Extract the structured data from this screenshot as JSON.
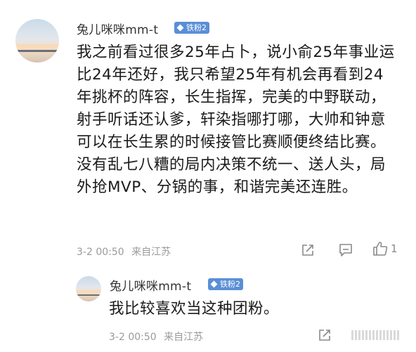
{
  "comments": [
    {
      "username": "兔儿咪咪mm-t",
      "badge": "铁粉2",
      "text": "我之前看过很多25年占卜，说小俞25年事业运比24年还好，我只希望25年有机会再看到24年挑杯的阵容，长生指挥，完美的中野联动，射手听话还认爹，轩染指哪打哪，大帅和钟意可以在长生累的时候接管比赛顺便终结比赛。没有乱七八糟的局内决策不统一、送人头，局外抢MVP、分锅的事，和谐完美还连胜。",
      "time": "3-2 00:50",
      "location": "来自江苏",
      "likes": "1"
    },
    {
      "username": "兔儿咪咪mm-t",
      "badge": "铁粉2",
      "text": "我比较喜欢当这种团粉。",
      "time": "3-2 00:50",
      "location": "来自江苏",
      "likes": ""
    }
  ],
  "colors": {
    "badge": "#5a8fd6",
    "meta": "#9a9a9a",
    "text": "#1a1a1a"
  },
  "icons": [
    "share-icon",
    "comment-icon",
    "like-icon"
  ]
}
